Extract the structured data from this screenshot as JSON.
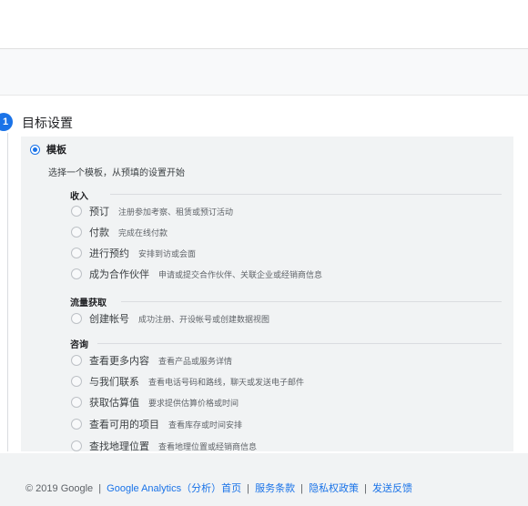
{
  "section": {
    "step_number": "1",
    "title": "目标设置"
  },
  "template": {
    "label": "模板",
    "description": "选择一个模板，从预填的设置开始"
  },
  "groups": [
    {
      "title": "收入",
      "options": [
        {
          "label": "预订",
          "desc": "注册参加考察、租赁或预订活动"
        },
        {
          "label": "付款",
          "desc": "完成在线付款"
        },
        {
          "label": "进行预约",
          "desc": "安排到访或会面"
        },
        {
          "label": "成为合作伙伴",
          "desc": "申请或提交合作伙伴、关联企业或经销商信息"
        }
      ]
    },
    {
      "title": "流量获取",
      "options": [
        {
          "label": "创建帐号",
          "desc": "成功注册、开设帐号或创建数据视图"
        }
      ]
    },
    {
      "title": "咨询",
      "options": [
        {
          "label": "查看更多内容",
          "desc": "查看产品或服务详情"
        },
        {
          "label": "与我们联系",
          "desc": "查看电话号码和路线，聊天或发送电子邮件"
        },
        {
          "label": "获取估算值",
          "desc": "要求提供估算价格或时间"
        },
        {
          "label": "查看可用的项目",
          "desc": "查看库存或时间安排"
        },
        {
          "label": "查找地理位置",
          "desc": "查看地理位置或经销商信息"
        }
      ]
    }
  ],
  "footer": {
    "copyright": "© 2019 Google",
    "links": [
      "Google Analytics（分析）首页",
      "服务条款",
      "隐私权政策",
      "发送反馈"
    ],
    "separator": "|"
  },
  "colors": {
    "accent": "#1a73e8",
    "panel_bg": "#f1f3f4"
  }
}
